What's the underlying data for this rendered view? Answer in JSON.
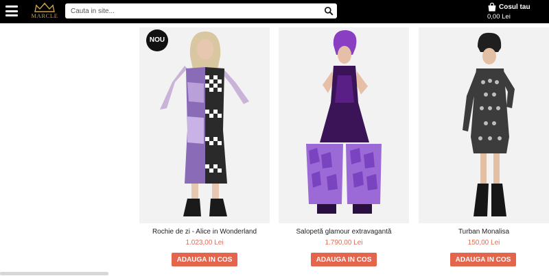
{
  "header": {
    "menu_icon": "hamburger-icon",
    "logo_text": "MARCLE",
    "search": {
      "placeholder": "Cauta in site...",
      "value": "",
      "icon": "search-icon"
    },
    "cart": {
      "title": "Cosul tau",
      "total": "0,00 Lei",
      "icon": "shopping-bag-icon"
    }
  },
  "products": [
    {
      "name": "Rochie de zi - Alice in Wonderland",
      "price": "1.023,00 Lei",
      "badge": "NOU",
      "button": "ADAUGA IN COS"
    },
    {
      "name": "Salopetă glamour extravagantă",
      "price": "1.790,00 Lei",
      "badge": "",
      "button": "ADAUGA IN COS"
    },
    {
      "name": "Turban Monalisa",
      "price": "150,00 Lei",
      "badge": "",
      "button": "ADAUGA IN COS"
    }
  ],
  "colors": {
    "topbar": "#000000",
    "accent": "#e2654c",
    "price": "#e26a55",
    "logo": "#c9a24a"
  }
}
